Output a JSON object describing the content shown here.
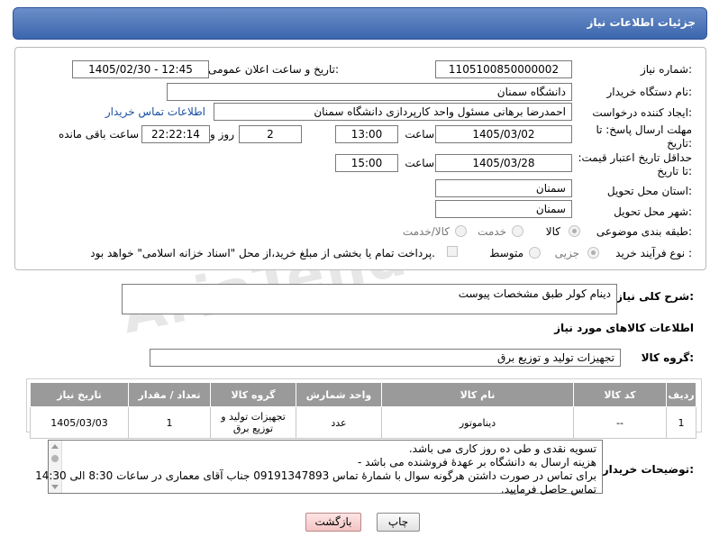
{
  "header": {
    "title": "جزئیات اطلاعات نیاز"
  },
  "form": {
    "need_number_label": "شماره نیاز:",
    "need_number": "1105100850000002",
    "announce_label": "تاریخ و ساعت اعلان عمومی:",
    "announce_value": "1405/02/30 - 12:45",
    "buyer_org_label": "نام دستگاه خریدار:",
    "buyer_org": "دانشگاه سمنان",
    "creator_label": "ایجاد کننده درخواست:",
    "creator": "احمدرضا برهانی مسئول واحد کارپردازی دانشگاه سمنان",
    "contact_link": "اطلاعات تماس خریدار",
    "deadline_label": "مهلت ارسال پاسخ: تا تاریخ:",
    "deadline_date": "1405/03/02",
    "time_label": "ساعت",
    "deadline_time": "13:00",
    "days_value": "2",
    "days_label": "روز و",
    "remaining_time": "22:22:14",
    "remaining_label": "ساعت باقی مانده",
    "validity_label": "حداقل تاریخ اعتبار قیمت: تا تاریخ:",
    "validity_date": "1405/03/28",
    "validity_time": "15:00",
    "province_label": "استان محل تحویل:",
    "province": "سمنان",
    "city_label": "شهر محل تحویل:",
    "city": "سمنان",
    "category_label": "طبقه بندی موضوعی:",
    "category_options": [
      "کالا",
      "خدمت",
      "کالا/خدمت"
    ],
    "process_label": "نوع فرآیند خرید :",
    "process_options": [
      "جزیی",
      "متوسط"
    ],
    "payment_note": "پرداخت تمام یا بخشی از مبلغ خرید،از محل \"اسناد خزانه اسلامی\" خواهد بود."
  },
  "description": {
    "label": "شرح کلی نیاز:",
    "value": "دینام کولر طبق مشخصات پیوست"
  },
  "goods_section": {
    "title": "اطلاعات کالاهای مورد نیاز"
  },
  "goods_group": {
    "label": "گروه کالا:",
    "value": "تجهیزات تولید و توزیع برق"
  },
  "table": {
    "headers": [
      "ردیف",
      "کد کالا",
      "نام کالا",
      "واحد شمارش",
      "گروه کالا",
      "تعداد / مقدار",
      "تاریخ نیاز"
    ],
    "rows": [
      [
        "1",
        "--",
        "دیناموتور",
        "عدد",
        "تجهیزات تولید و توزیع برق",
        "1",
        "1405/03/03"
      ]
    ]
  },
  "buyer_notes": {
    "label": "توضیحات خریدار:",
    "lines": [
      "تسویه نقدی و طی ده روز کاری می باشد.",
      "هزینه ارسال به دانشگاه بر عهدهٔ فروشنده می باشد -",
      "برای تماس در صورت داشتن هرگونه سوال با شمارهٔ تماس 09191347893 جناب آقای معماری در ساعات 8:30 الی 14:30",
      "تماس حاصل فرمایید."
    ]
  },
  "buttons": {
    "print": "چاپ",
    "back": "بازگشت"
  },
  "watermark": "AriaTender.neT"
}
